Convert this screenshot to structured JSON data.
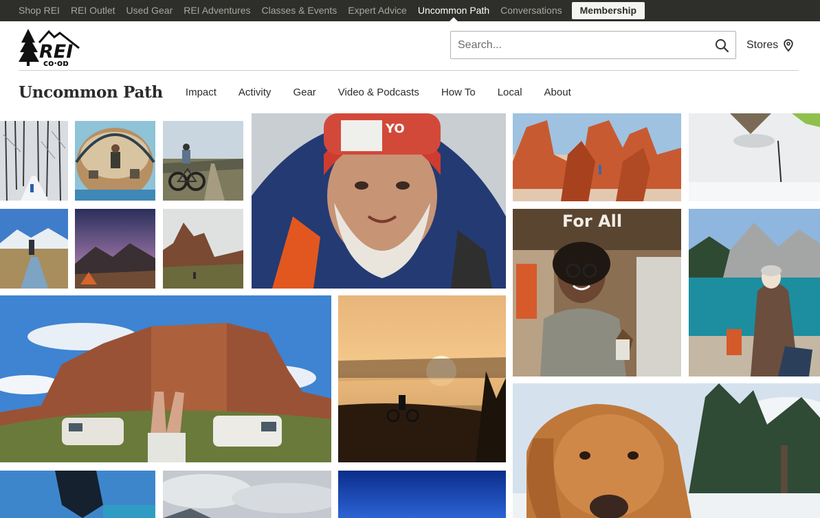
{
  "top_nav": {
    "items": [
      "Shop REI",
      "REI Outlet",
      "Used Gear",
      "REI Adventures",
      "Classes & Events",
      "Expert Advice",
      "Uncommon Path",
      "Conversations"
    ],
    "active": "Uncommon Path",
    "membership_label": "Membership"
  },
  "header": {
    "logo_text": "REI co-op",
    "search_placeholder": "Search...",
    "stores_label": "Stores"
  },
  "subnav": {
    "brand": "Uncommon Path",
    "items": [
      "Impact",
      "Activity",
      "Gear",
      "Video & Podcasts",
      "How To",
      "Local",
      "About"
    ]
  },
  "tile_banner_text": "For All",
  "colors": {
    "topbar_bg": "#2e2e2b",
    "topbar_text": "#a7a7a0",
    "text": "#2b2b2b"
  }
}
